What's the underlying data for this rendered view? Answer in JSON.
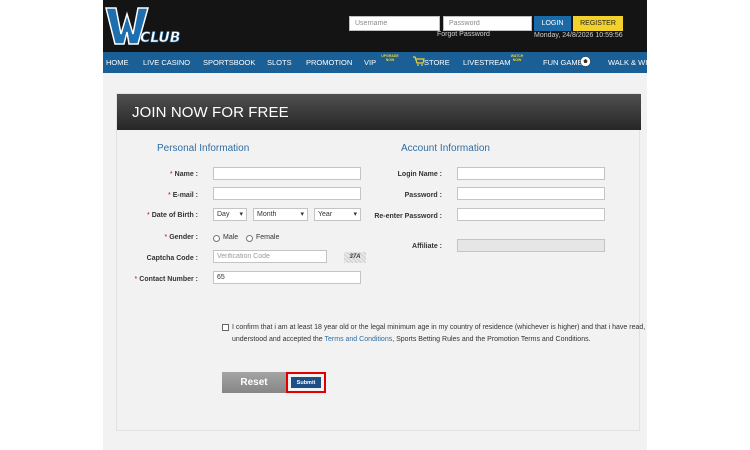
{
  "header": {
    "logo_text": "WCLUB",
    "username_placeholder": "Username",
    "password_placeholder": "Password",
    "login_label": "LOGIN",
    "register_label": "REGISTER",
    "forgot_password": "Forgot Password",
    "datetime": "Monday, 24/8/2026 10:59:56"
  },
  "nav": {
    "items": [
      "HOME",
      "LIVE CASINO",
      "SPORTSBOOK",
      "SLOTS",
      "PROMOTION",
      "VIP",
      "STORE",
      "LIVESTREAM",
      "FUN GAME",
      "WALK & WIN"
    ],
    "vip_badge": "UPGRADE NOW",
    "livestream_badge": "WATCH NOW"
  },
  "form": {
    "title": "JOIN NOW FOR FREE",
    "personal_title": "Personal Information",
    "account_title": "Account Information",
    "name_label": "Name :",
    "email_label": "E-mail :",
    "dob_label": "Date of Birth :",
    "day": "Day",
    "month": "Month",
    "year": "Year",
    "gender_label": "Gender :",
    "male": "Male",
    "female": "Female",
    "captcha_label": "Captcha Code :",
    "captcha_placeholder": "Verification Code",
    "captcha_value": "37A",
    "contact_label": "Contact Number :",
    "contact_value": "65",
    "login_name_label": "Login Name :",
    "password_label": "Password :",
    "reenter_label": "Re-enter Password :",
    "affiliate_label": "Affiliate :",
    "confirm_text": "I confirm that i am at least 18 year old or the legal minimum age in my country of residence (whichever is higher) and that i have read, understood and accepted the ",
    "terms_link": "Terms and Conditions",
    "confirm_tail": ", Sports Betting Rules and the Promotion Terms and Conditions.",
    "reset_label": "Reset",
    "submit_label": "Submit"
  },
  "colors": {
    "nav_blue": "#1a5f96",
    "accent_yellow": "#f3d12b",
    "link_blue": "#2e6ea4",
    "highlight_red": "#e00000"
  }
}
